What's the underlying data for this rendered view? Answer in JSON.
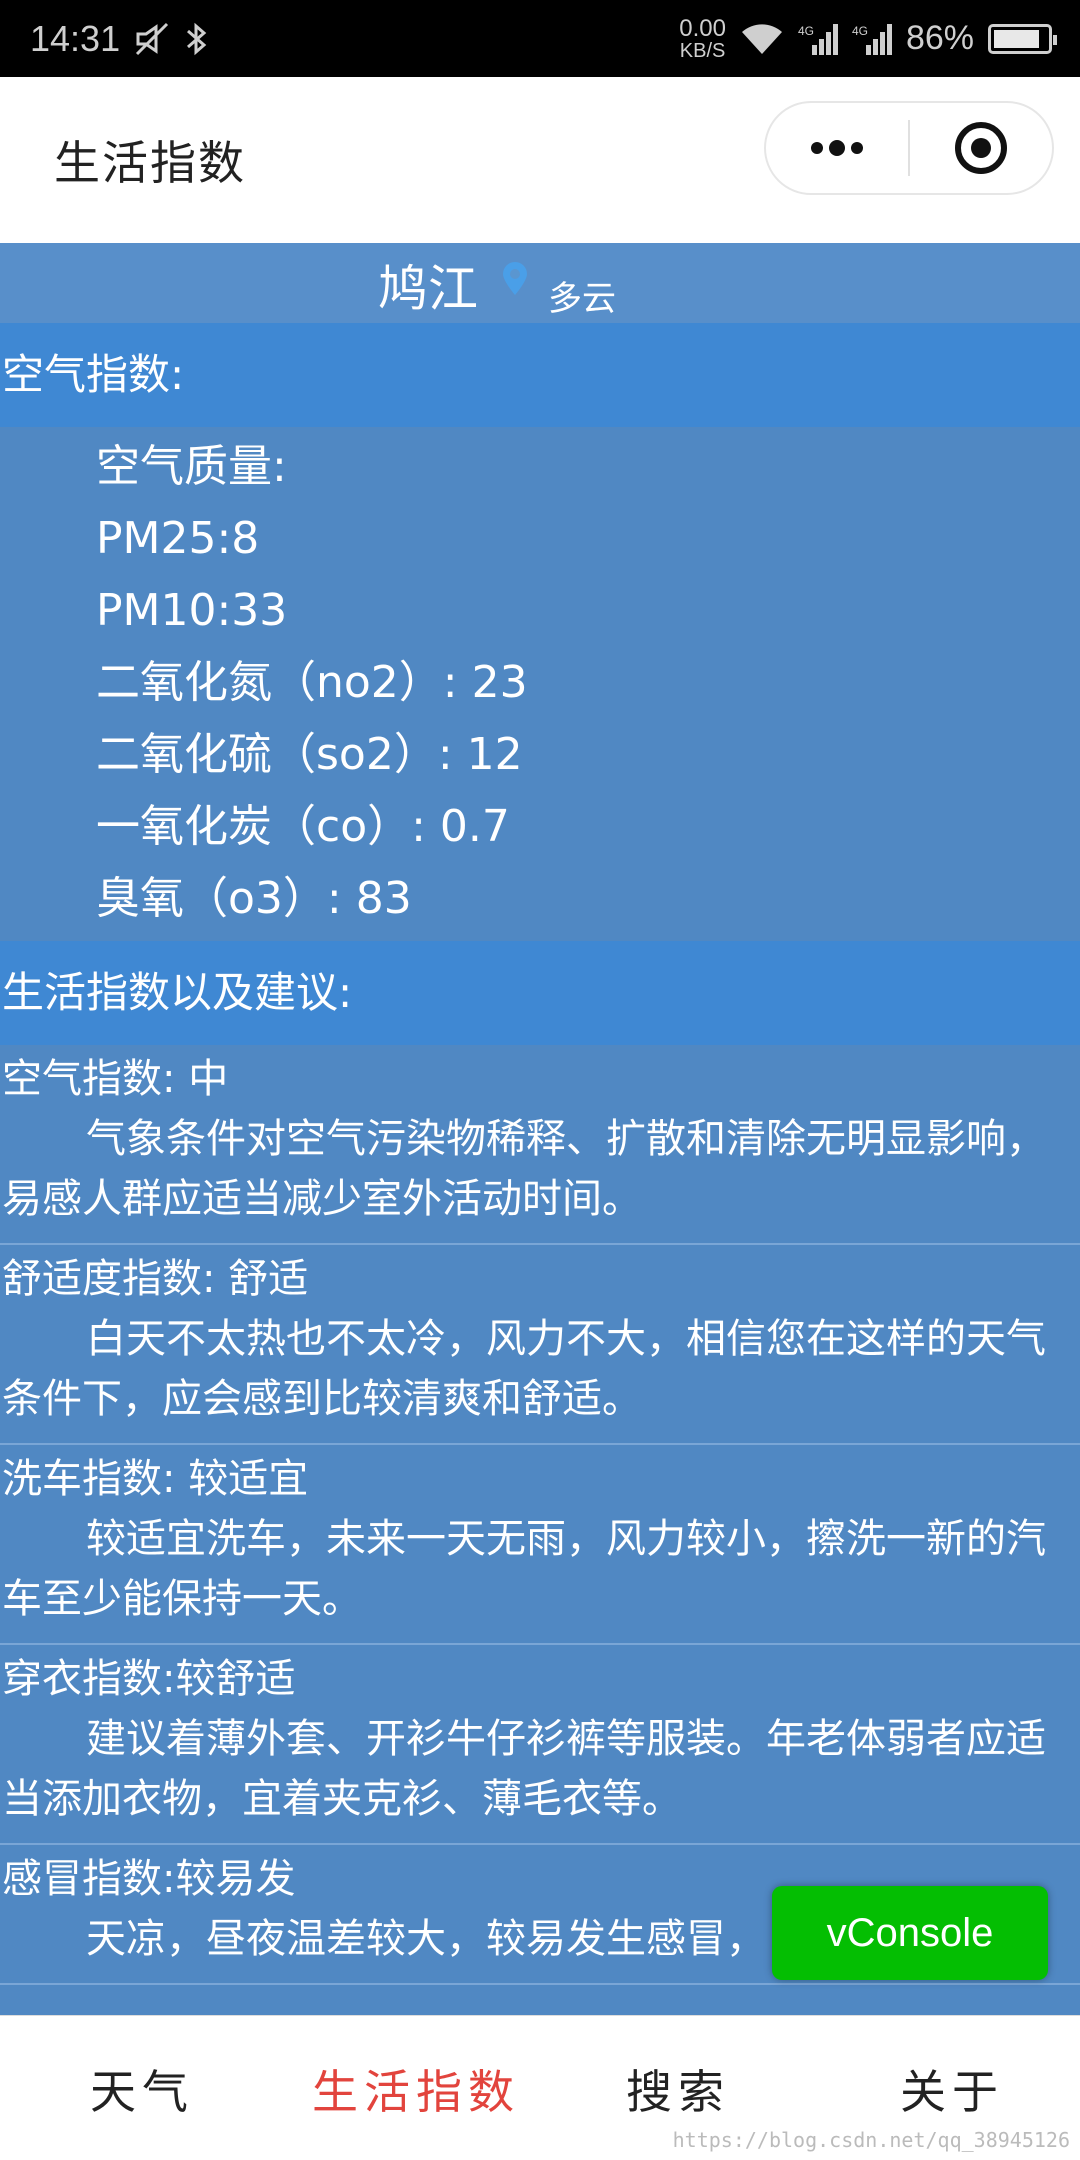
{
  "status_bar": {
    "time": "14:31",
    "net_speed_value": "0.00",
    "net_speed_unit": "KB/S",
    "battery": "86%",
    "battery_level": 0.86
  },
  "nav": {
    "title": "生活指数"
  },
  "location": {
    "city": "鸠江",
    "weather": "多云"
  },
  "air_section": {
    "heading": "空气指数:",
    "lines": [
      "空气质量:",
      "PM25:8",
      "PM10:33",
      "二氧化氮（no2）: 23",
      "二氧化硫（so2）: 12",
      "一氧化炭（co）: 0.7",
      "臭氧（o3）: 83"
    ]
  },
  "life_section": {
    "heading": "生活指数以及建议:",
    "items": [
      {
        "title": "空气指数: 中",
        "desc": "气象条件对空气污染物稀释、扩散和清除无明显影响，易感人群应适当减少室外活动时间。"
      },
      {
        "title": "舒适度指数: 舒适",
        "desc": "白天不太热也不太冷，风力不大，相信您在这样的天气条件下，应会感到比较清爽和舒适。"
      },
      {
        "title": "洗车指数: 较适宜",
        "desc": "较适宜洗车，未来一天无雨，风力较小，擦洗一新的汽车至少能保持一天。"
      },
      {
        "title": "穿衣指数:较舒适",
        "desc": "建议着薄外套、开衫牛仔衫裤等服装。年老体弱者应适当添加衣物，宜着夹克衫、薄毛衣等。"
      },
      {
        "title": "感冒指数:较易发",
        "desc": "天凉，昼夜温差较大，较易发生感冒，"
      }
    ]
  },
  "vconsole": {
    "label": "vConsole"
  },
  "tabs": [
    {
      "label": "天气"
    },
    {
      "label": "生活指数"
    },
    {
      "label": "搜索"
    },
    {
      "label": "关于"
    }
  ],
  "watermark": "https://blog.csdn.net/qq_38945126",
  "colors": {
    "content_bg": "#5088c3",
    "section_head_bg": "#3f88d3",
    "tab_active": "#e2443d",
    "vconsole_bg": "#04be02"
  }
}
